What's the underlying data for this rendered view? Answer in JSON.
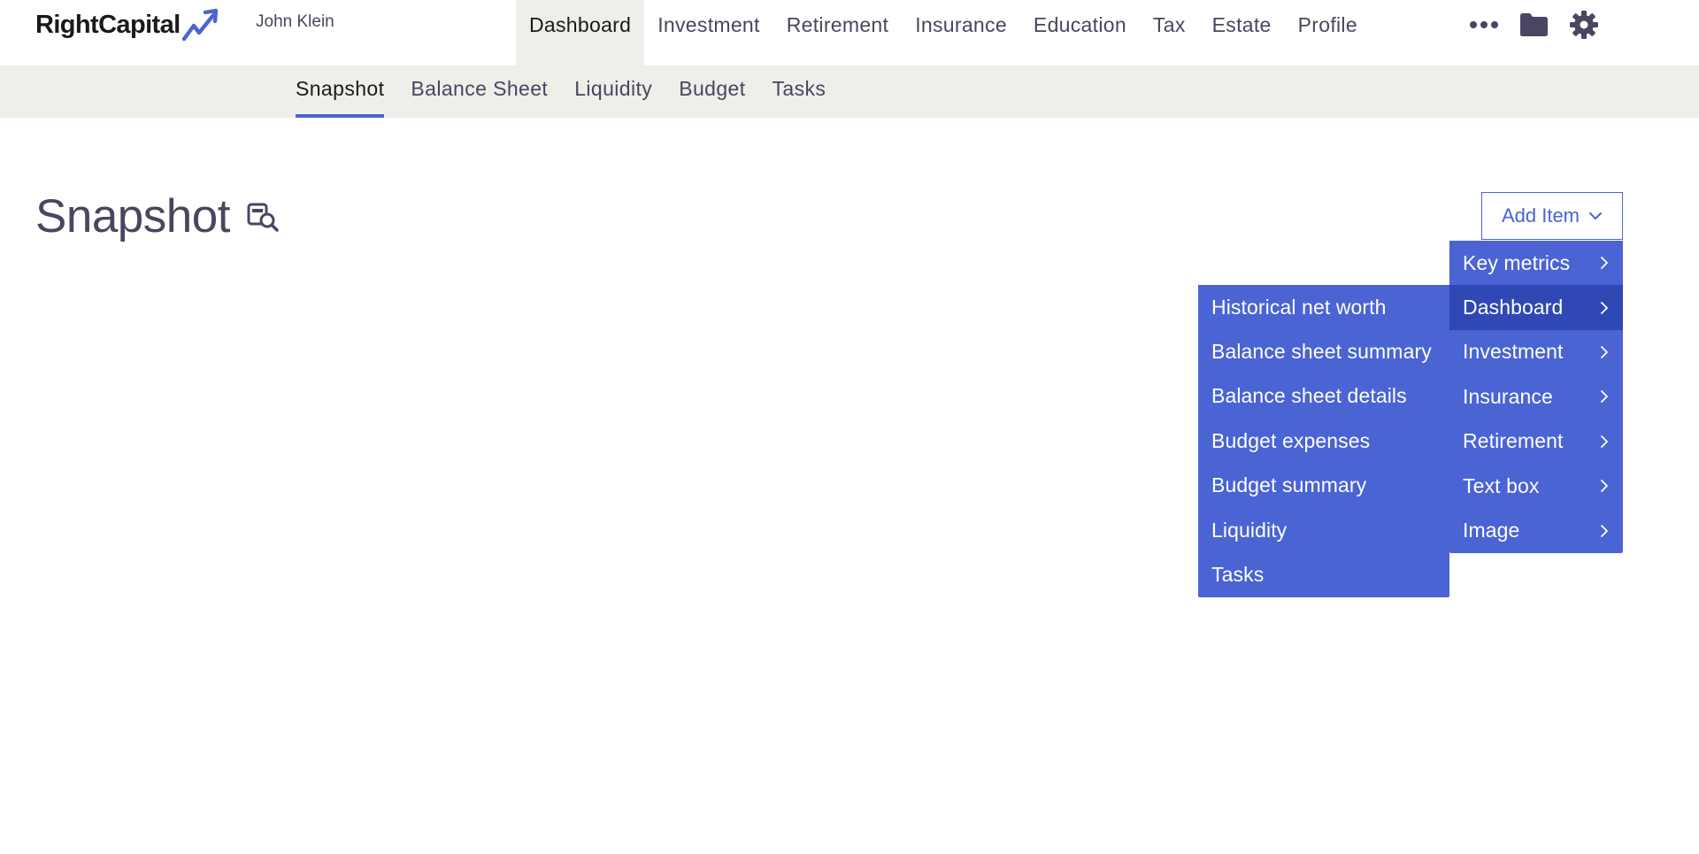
{
  "brand": {
    "logo_text": "RightCapital",
    "accent_color": "#4a64d4",
    "menu_color": "#4a64d4",
    "menu_active_color": "#2f48b4"
  },
  "header": {
    "client_name": "John Klein",
    "nav": [
      {
        "label": "Dashboard",
        "active": true
      },
      {
        "label": "Investment",
        "active": false
      },
      {
        "label": "Retirement",
        "active": false
      },
      {
        "label": "Insurance",
        "active": false
      },
      {
        "label": "Education",
        "active": false
      },
      {
        "label": "Tax",
        "active": false
      },
      {
        "label": "Estate",
        "active": false
      },
      {
        "label": "Profile",
        "active": false
      }
    ],
    "icons": [
      "more-icon",
      "folder-icon",
      "gear-icon"
    ]
  },
  "subnav": {
    "items": [
      {
        "label": "Snapshot",
        "active": true
      },
      {
        "label": "Balance Sheet",
        "active": false
      },
      {
        "label": "Liquidity",
        "active": false
      },
      {
        "label": "Budget",
        "active": false
      },
      {
        "label": "Tasks",
        "active": false
      }
    ]
  },
  "main": {
    "title": "Snapshot",
    "add_item_label": "Add Item"
  },
  "menu": {
    "primary": [
      {
        "label": "Key metrics",
        "active": false
      },
      {
        "label": "Dashboard",
        "active": true
      },
      {
        "label": "Investment",
        "active": false
      },
      {
        "label": "Insurance",
        "active": false
      },
      {
        "label": "Retirement",
        "active": false
      },
      {
        "label": "Text box",
        "active": false
      },
      {
        "label": "Image",
        "active": false
      }
    ],
    "secondary": [
      {
        "label": "Historical net worth"
      },
      {
        "label": "Balance sheet summary"
      },
      {
        "label": "Balance sheet details"
      },
      {
        "label": "Budget expenses"
      },
      {
        "label": "Budget summary"
      },
      {
        "label": "Liquidity"
      },
      {
        "label": "Tasks"
      }
    ]
  }
}
